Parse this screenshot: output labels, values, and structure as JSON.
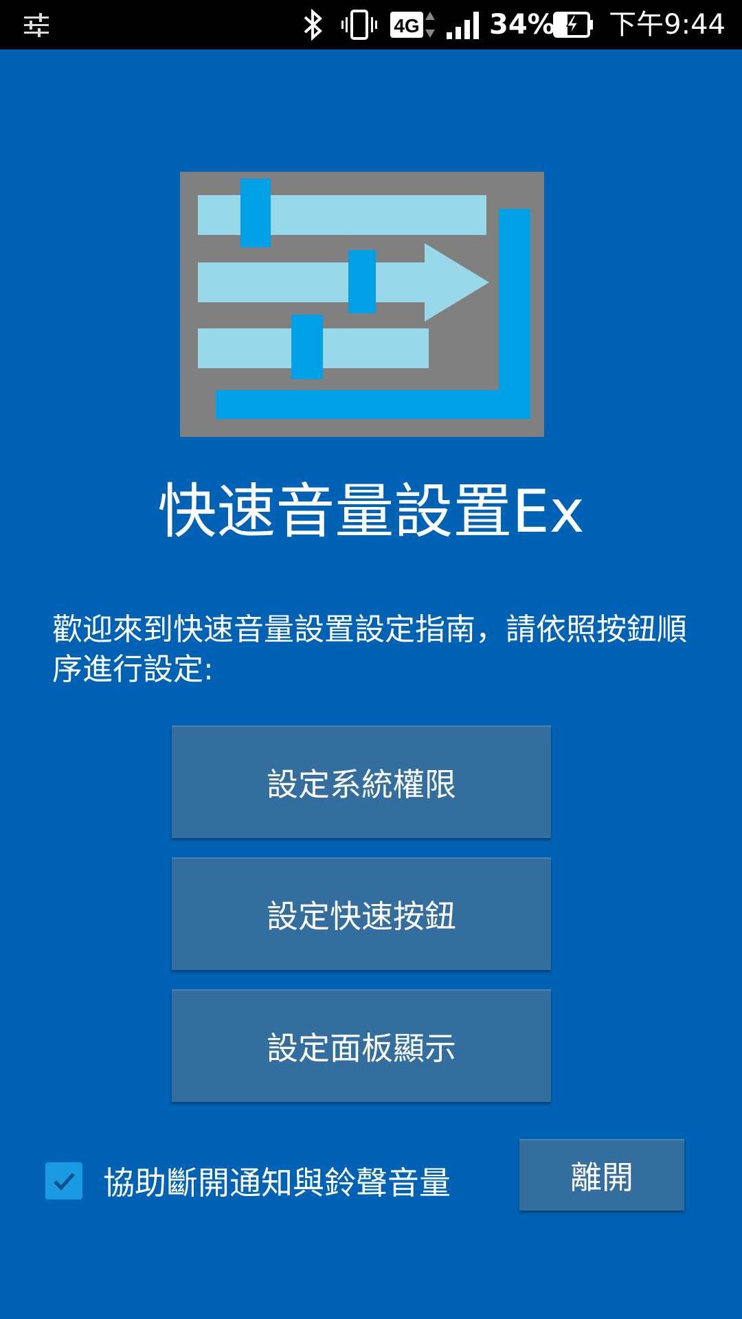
{
  "status_bar": {
    "network_type": "4G",
    "battery_percent": "34%",
    "time": "下午9:44",
    "icons": [
      "tune-icon",
      "bluetooth-icon",
      "vibrate-icon",
      "network-4g-icon",
      "signal-icon",
      "battery-charging-icon"
    ]
  },
  "app": {
    "title": "快速音量設置Ex",
    "intro": "歡迎來到快速音量設置設定指南，請依照按鈕順序進行設定:",
    "logo_icon": "volume-sliders-logo-icon"
  },
  "buttons": {
    "permission": "設定系統權限",
    "quick_button": "設定快速按鈕",
    "panel_display": "設定面板顯示",
    "leave": "離開"
  },
  "assist_option": {
    "label": "協助斷開通知與鈴聲音量",
    "checked": true
  },
  "colors": {
    "background": "#0062b4",
    "button": "#336e9e",
    "checkbox": "#1a9ae0",
    "logo_frame": "#808080",
    "logo_track": "#98d8e8",
    "logo_accent": "#00a0e6"
  }
}
